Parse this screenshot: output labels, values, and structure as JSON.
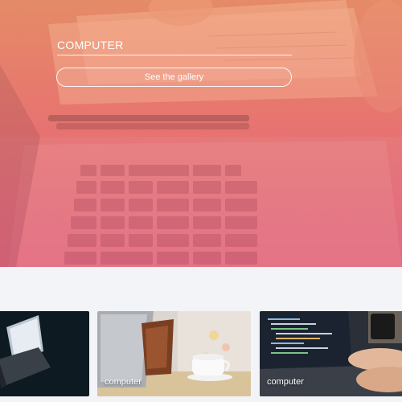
{
  "hero": {
    "title": "COMPUTER",
    "button_label": "See the gallery"
  },
  "gallery": {
    "cards": [
      {
        "label": ""
      },
      {
        "label": "computer"
      },
      {
        "label": "computer"
      }
    ]
  }
}
